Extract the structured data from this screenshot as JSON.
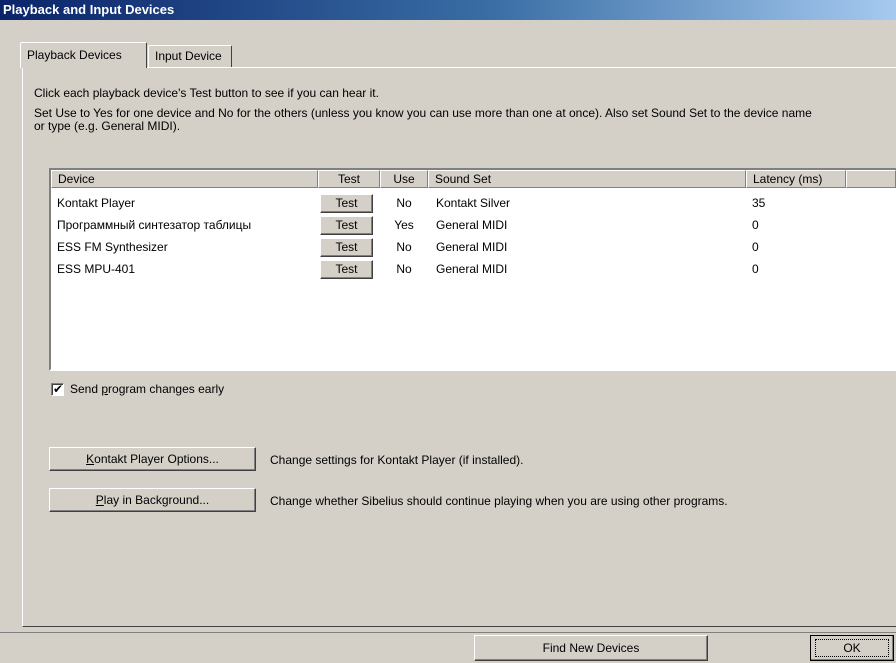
{
  "window": {
    "title": "Playback and Input Devices"
  },
  "tabs": [
    {
      "label": "Playback Devices",
      "active": true
    },
    {
      "label": "Input Device",
      "active": false
    }
  ],
  "instructions": {
    "line1": "Click each playback device's Test button to see if you can hear it.",
    "line2": "Set Use to Yes for one device and No for the others (unless you know you can use more than one at once). Also set Sound Set to the device name",
    "line3": "or type (e.g. General MIDI)."
  },
  "device_list": {
    "columns": [
      "Device",
      "Test",
      "Use",
      "Sound Set",
      "Latency (ms)"
    ],
    "rows": [
      {
        "device": "Kontakt Player",
        "test": "Test",
        "use": "No",
        "sound_set": "Kontakt Silver",
        "latency": "35"
      },
      {
        "device": "Программный синтезатор таблицы",
        "test": "Test",
        "use": "Yes",
        "sound_set": "General MIDI",
        "latency": "0"
      },
      {
        "device": "ESS FM Synthesizer",
        "test": "Test",
        "use": "No",
        "sound_set": "General MIDI",
        "latency": "0"
      },
      {
        "device": "ESS MPU-401",
        "test": "Test",
        "use": "No",
        "sound_set": "General MIDI",
        "latency": "0"
      }
    ]
  },
  "send_program_changes": {
    "checked": true,
    "label_pre": "Send ",
    "label_accel": "p",
    "label_post": "rogram changes early"
  },
  "kontakt_options": {
    "accel": "K",
    "label_rest": "ontakt Player Options...",
    "description": "Change settings for Kontakt Player (if installed)."
  },
  "play_background": {
    "accel": "P",
    "label_rest": "lay in Background...",
    "description": "Change whether Sibelius should continue playing when you are using other programs."
  },
  "footer": {
    "find_new_devices": "Find New Devices",
    "ok": "OK"
  },
  "colors": {
    "face": "#d4d0c8",
    "title_start": "#0a246a",
    "title_end": "#a6caf0"
  }
}
